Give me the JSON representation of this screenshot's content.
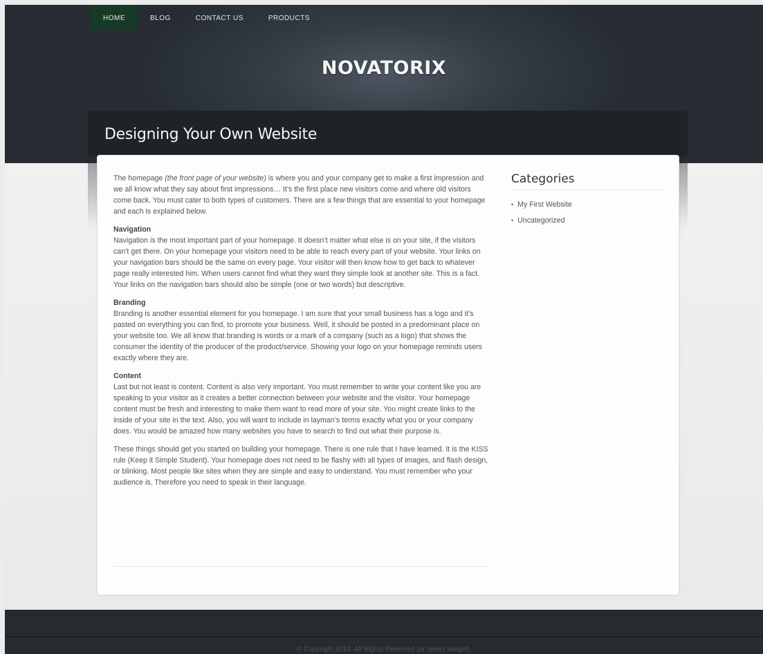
{
  "nav": {
    "items": [
      {
        "label": "HOME",
        "active": true
      },
      {
        "label": "BLOG"
      },
      {
        "label": "CONTACT US"
      },
      {
        "label": "PRODUCTS"
      }
    ]
  },
  "site": {
    "logo": "NOVATORIX"
  },
  "post": {
    "title": "Designing Your Own Website",
    "intro": {
      "before": "The homepage ",
      "emphasis": "(the front page of your website)",
      "after": " is where you and your company get to make a first impression and we all know what they say about first impressions… It’s the first place new visitors come and where old visitors come back. You must cater to both types of customers. There are a few things that are essential to your homepage and each is explained below."
    },
    "sections": [
      {
        "heading": "Navigation",
        "body": "Navigation is the most important part of your homepage. It doesn’t matter what else is on your site, if the visitors can’t get there. On your homepage your visitors need to be able to reach every part of your website. Your links on your navigation bars should be the same on every page. Your visitor will then know how to get back to whatever page really interested him. When users cannot find what they want they simple look at another site. This is a fact. Your links on the navigation bars should also be simple (one or two words) but descriptive."
      },
      {
        "heading": "Branding",
        "body": "Branding is another essential element for you homepage. I am sure that your small business has a logo and it’s pasted on everything you can find, to promote your business. Well, it should be posted in a predominant place on your website too. We all know that branding is words or a mark of a company (such as a logo) that shows the consumer the identity of the producer of the product/service. Showing your logo on your homepage reminds users exactly where they are."
      },
      {
        "heading": "Content",
        "body": "Last but not least is content. Content is also very important. You must remember to write your content like you are speaking to your visitor as it creates a better connection between your website and the visitor. Your homepage content must be fresh and interesting to make them want to read more of your site. You might create links to the inside of your site in the text. Also, you will want to include in layman’s terms exactly what you or your company does. You would be amazed how many websites you have to search to find out what their purpose is."
      }
    ],
    "closing": "These things should get you started on building your homepage. There is one rule that I have learned. It is the KISS rule (Keep it Simple Student). Your homepage does not need to be flashy with all types of images, and flash design, or blinking. Most people like sites when they are simple and easy to understand. You must remember who your audience is. Therefore you need to speak in their language."
  },
  "sidebar": {
    "title": "Categories",
    "categories": [
      "My First Website",
      "Uncategorized"
    ]
  },
  "footer": {
    "copyright": "© Copyright 2010. All Rights Reserved (or select widget)."
  }
}
